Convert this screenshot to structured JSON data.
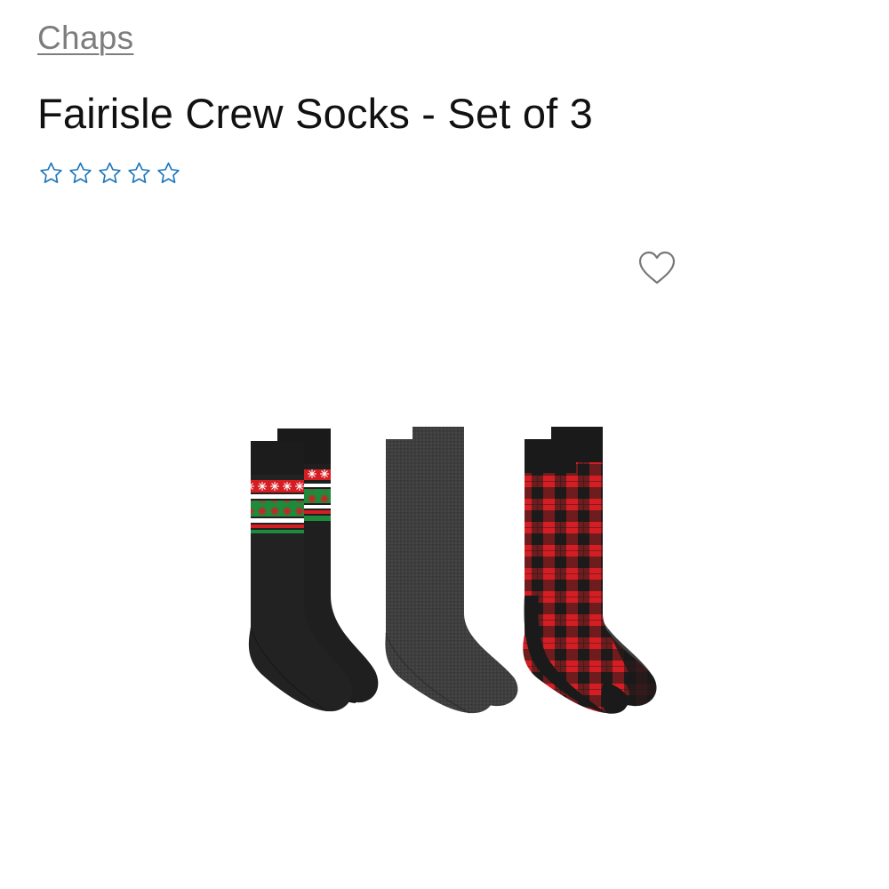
{
  "product": {
    "brand": "Chaps",
    "title": "Fairisle Crew Socks - Set of 3",
    "rating": {
      "stars_filled": 0,
      "stars_total": 5,
      "star_color": "#1b75bb"
    }
  },
  "icons": {
    "wishlist": "heart-outline-icon",
    "rating_star": "star-outline-icon"
  },
  "colors": {
    "brand_link": "#7d7d7d",
    "title": "#111111",
    "star": "#1b75bb",
    "heart": "#777777",
    "sock_black": "#1a1a1a",
    "sock_charcoal": "#3d3d3d",
    "sock_red": "#d41e24",
    "sock_green": "#1e8a3c"
  }
}
